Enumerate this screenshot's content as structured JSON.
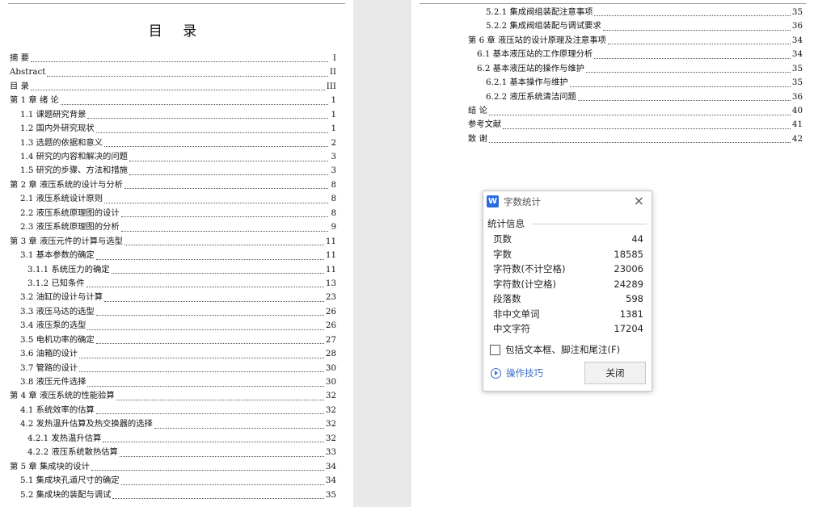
{
  "left_page": {
    "title": "目  录",
    "entries": [
      {
        "t": "摘  要",
        "p": "I",
        "lvl": 0
      },
      {
        "t": "Abstract",
        "p": "II",
        "lvl": 0
      },
      {
        "t": "目  录",
        "p": "III",
        "lvl": 0
      },
      {
        "t": "第 1 章  绪  论",
        "p": "1",
        "lvl": 0
      },
      {
        "t": "1.1 课题研究背景",
        "p": "1",
        "lvl": 1
      },
      {
        "t": "1.2 国内外研究现状",
        "p": "1",
        "lvl": 1
      },
      {
        "t": "1.3 选题的依据和意义",
        "p": "2",
        "lvl": 1
      },
      {
        "t": "1.4 研究的内容和解决的问题",
        "p": "3",
        "lvl": 1
      },
      {
        "t": "1.5 研究的步骤、方法和措施",
        "p": "3",
        "lvl": 1
      },
      {
        "t": "第 2 章  液压系统的设计与分析",
        "p": "8",
        "lvl": 0
      },
      {
        "t": "2.1 液压系统设计原则",
        "p": "8",
        "lvl": 1
      },
      {
        "t": "2.2 液压系统原理图的设计",
        "p": "8",
        "lvl": 1
      },
      {
        "t": "2.3 液压系统原理图的分析",
        "p": "9",
        "lvl": 1
      },
      {
        "t": "第 3 章  液压元件的计算与选型",
        "p": "11",
        "lvl": 0
      },
      {
        "t": "3.1 基本参数的确定",
        "p": "11",
        "lvl": 1
      },
      {
        "t": "3.1.1  系统压力的确定",
        "p": "11",
        "lvl": 2
      },
      {
        "t": "3.1.2  已知条件",
        "p": "13",
        "lvl": 2
      },
      {
        "t": "3.2 油缸的设计与计算",
        "p": "23",
        "lvl": 1
      },
      {
        "t": "3.3 液压马达的选型",
        "p": "26",
        "lvl": 1
      },
      {
        "t": "3.4 液压泵的选型",
        "p": "26",
        "lvl": 1
      },
      {
        "t": "3.5 电机功率的确定",
        "p": "27",
        "lvl": 1
      },
      {
        "t": "3.6 油箱的设计",
        "p": "28",
        "lvl": 1
      },
      {
        "t": "3.7 管路的设计",
        "p": "30",
        "lvl": 1
      },
      {
        "t": "3.8 液压元件选择",
        "p": "30",
        "lvl": 1
      },
      {
        "t": "第 4 章  液压系统的性能验算",
        "p": "32",
        "lvl": 0
      },
      {
        "t": "4.1 系统效率的估算",
        "p": "32",
        "lvl": 1
      },
      {
        "t": "4.2 发热温升估算及热交换器的选择",
        "p": "32",
        "lvl": 1
      },
      {
        "t": "4.2.1  发热温升估算",
        "p": "32",
        "lvl": 2
      },
      {
        "t": "4.2.2  液压系统散热估算",
        "p": "33",
        "lvl": 2
      },
      {
        "t": "第 5 章  集成块的设计",
        "p": "34",
        "lvl": 0
      },
      {
        "t": "5.1 集成块孔道尺寸的确定",
        "p": "34",
        "lvl": 1
      },
      {
        "t": "5.2 集成块的装配与调试",
        "p": "35",
        "lvl": 1
      }
    ]
  },
  "right_page": {
    "entries": [
      {
        "t": "5.2.1  集成阀组装配注意事项",
        "p": "35",
        "lvl": 2
      },
      {
        "t": "5.2.2  集成阀组装配与调试要求",
        "p": "36",
        "lvl": 2
      },
      {
        "t": "第 6 章  液压站的设计原理及注意事项",
        "p": "34",
        "lvl": 0
      },
      {
        "t": "6.1 基本液压站的工作原理分析",
        "p": "34",
        "lvl": 1
      },
      {
        "t": "6.2 基本液压站的操作与维护",
        "p": "35",
        "lvl": 1
      },
      {
        "t": "6.2.1  基本操作与维护",
        "p": "35",
        "lvl": 2
      },
      {
        "t": "6.2.2  液压系统清洁问题",
        "p": "36",
        "lvl": 2
      },
      {
        "t": "结  论",
        "p": "40",
        "lvl": 0
      },
      {
        "t": "参考文献",
        "p": "41",
        "lvl": 0
      },
      {
        "t": "致  谢",
        "p": "42",
        "lvl": 0
      }
    ]
  },
  "dialog": {
    "app_icon": "W",
    "title": "字数统计",
    "section_label": "统计信息",
    "stats": [
      {
        "label": "页数",
        "value": "44"
      },
      {
        "label": "字数",
        "value": "18585"
      },
      {
        "label": "字符数(不计空格)",
        "value": "23006"
      },
      {
        "label": "字符数(计空格)",
        "value": "24289"
      },
      {
        "label": "段落数",
        "value": "598"
      },
      {
        "label": "非中文单词",
        "value": "1381"
      },
      {
        "label": "中文字符",
        "value": "17204"
      }
    ],
    "checkbox_label": "包括文本框、脚注和尾注(F)",
    "checkbox_checked": false,
    "tips_label": "操作技巧",
    "close_label": "关闭",
    "close_icon": "×"
  }
}
